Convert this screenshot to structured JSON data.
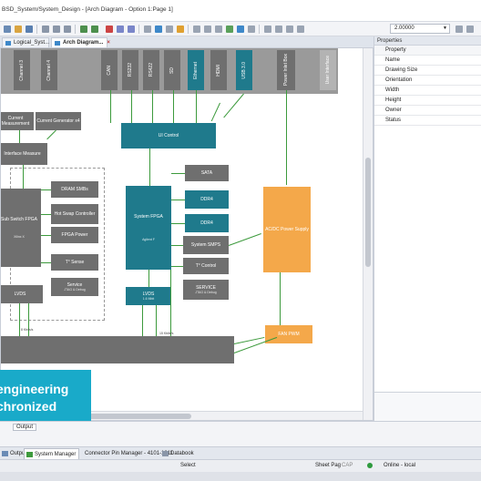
{
  "window": {
    "title": "BSD_System/System_Design - [Arch Diagram - Option 1:Page 1]"
  },
  "toolbar": {
    "zoom_value": "2.00000"
  },
  "tabs": [
    {
      "label": "Logical_Syst..."
    },
    {
      "label": "Arch Diagram..."
    }
  ],
  "properties": {
    "title": "Properties",
    "header": "Property",
    "rows": [
      "Name",
      "Drawing Size",
      "Orientation",
      "Width",
      "Height",
      "Owner",
      "Status"
    ]
  },
  "diagram": {
    "top_row_blocks": [
      "Channel 3",
      "Channel 4",
      "CAN",
      "RS232",
      "RS422",
      "SD",
      "Ethernet",
      "HDMI",
      "USB 3.0",
      "Power Inlet Box",
      "User Interface"
    ],
    "current_measurement": "Current Measurement",
    "current_generator": "Current Generator x4",
    "interface_measure": "Interface Measure",
    "ui_control": "UI Control",
    "sub_switch_fpga": "Sub Switch FPGA",
    "sub_switch_sub": "Xilinx X",
    "dram_smbs": "DRAM SMBs",
    "hot_swap": "Hot Swap Controller",
    "fpga_power": "FPGA Power",
    "t_sense": "T° Sense",
    "service_left": "Service",
    "service_left_sub": "JTAG & Debug",
    "lvds_left": "LVDS",
    "system_fpga": "System FPGA",
    "system_fpga_sub": "Agilent F",
    "sata": "SATA",
    "ddr4_a": "DDR4",
    "ddr4_b": "DDR4",
    "system_smps": "System SMPS",
    "t_control": "T° Control",
    "service_right": "SERVICE",
    "service_right_sub": "JTAG & Debug",
    "lvds_center": "LVDS",
    "lvds_center_sub": "1.6 Mbit",
    "acdc": "AC/DC Power Supply",
    "fan_ctrl": "FAN PWM",
    "bus_label_1": "8 Kbits/s",
    "bus_label_2": "15 Kbits/s"
  },
  "promo": {
    "line1": "engineering",
    "line2": "chronized"
  },
  "output_pane": {
    "label": "Output"
  },
  "bottom_tabs": [
    "Output",
    "System Manager",
    "Connector Pin Manager - 4101-1011",
    "Databook"
  ],
  "status": {
    "mode": "Select",
    "sheet": "Sheet Pag",
    "caps": "CAP",
    "connection": "Online - local"
  }
}
